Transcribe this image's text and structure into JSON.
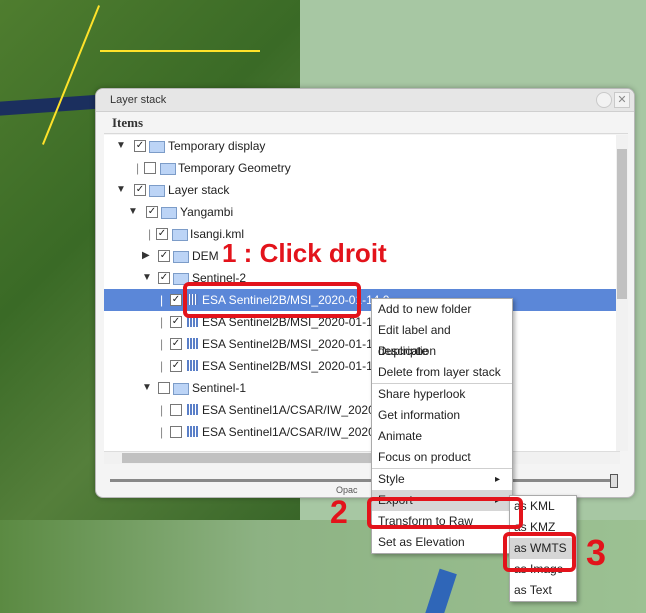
{
  "window": {
    "title": "Layer stack",
    "close_label": "✕"
  },
  "items_header": "Items",
  "tree": [
    {
      "label": "Temporary display",
      "checked": true
    },
    {
      "label": "Temporary Geometry",
      "checked": false
    },
    {
      "label": "Layer stack",
      "checked": true
    },
    {
      "label": "Yangambi",
      "checked": true
    },
    {
      "label": "Isangi.kml",
      "checked": true
    },
    {
      "label": "DEM",
      "checked": true
    },
    {
      "label": "Sentinel-2",
      "checked": true
    },
    {
      "label": "ESA Sentinel2B/MSI_2020-01-14 0",
      "checked": true,
      "selected": true
    },
    {
      "label": "ESA Sentinel2B/MSI_2020-01-14 0",
      "checked": true
    },
    {
      "label": "ESA Sentinel2B/MSI_2020-01-14 0",
      "checked": true
    },
    {
      "label": "ESA Sentinel2B/MSI_2020-01-14 0",
      "checked": true
    },
    {
      "label": "Sentinel-1",
      "checked": false
    },
    {
      "label": "ESA Sentinel1A/CSAR/IW_2020-02",
      "checked": false
    },
    {
      "label": "ESA Sentinel1A/CSAR/IW_2020-01",
      "checked": false
    }
  ],
  "opacity_label": "Opac",
  "context_menu": [
    "Add to new folder",
    "Edit label and description",
    "Duplicate",
    "Delete from layer stack",
    "Share hyperlook",
    "Get information",
    "Animate",
    "Focus on product",
    "Style",
    "Export",
    "Transform to Raw",
    "Set as Elevation"
  ],
  "export_submenu": [
    "as KML",
    "as KMZ",
    "as WMTS",
    "as Image",
    "as Text"
  ],
  "annotations": {
    "step1": "1 : Click droit",
    "step2": "2",
    "step3": "3"
  },
  "colors": {
    "annotation": "#e3131b",
    "selection": "#5b87d8"
  }
}
